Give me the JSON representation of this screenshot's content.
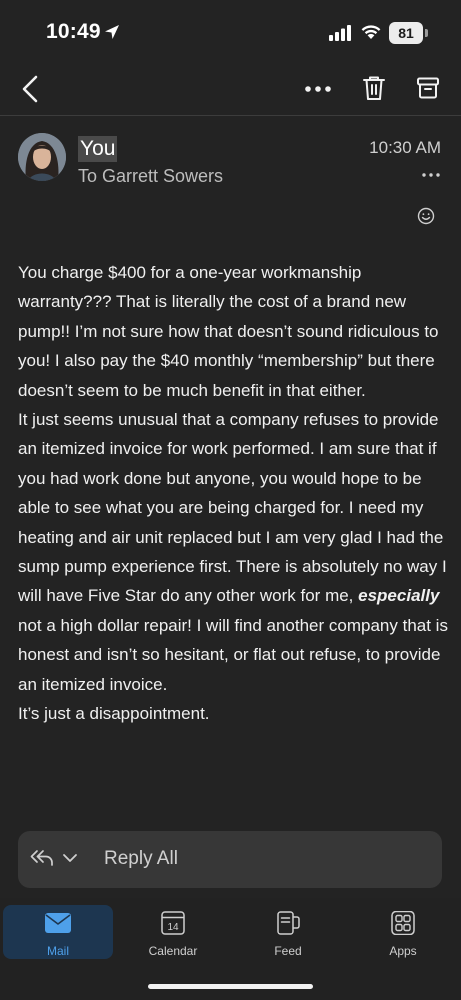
{
  "status_bar": {
    "time": "10:49",
    "battery": "81"
  },
  "toolbar": {
    "back_icon": "chevron-left-icon",
    "more_icon": "ellipsis-icon",
    "delete_icon": "trash-icon",
    "archive_icon": "archive-icon"
  },
  "message": {
    "sender": "You",
    "recipient": "To Garrett Sowers",
    "time": "10:30 AM",
    "body": {
      "p1": "You charge $400 for a one-year workmanship warranty??? That is literally the cost of a brand new pump!! I’m not sure how that doesn’t sound ridiculous to you!  I also pay the $40 monthly “membership” but there doesn’t seem to be much benefit in that either.",
      "p2_before": "It just seems unusual  that a company refuses to provide an itemized invoice for work performed. I am sure that if you had work done but anyone, you would hope to be able to see what you are being charged for. I need my heating and air unit replaced but I am very glad I had the sump pump experience first. There is absolutely no way I will have Five Star do any other work for me, ",
      "p2_emphasis": "especially",
      "p2_after": " not a high dollar repair! I will find another company that is honest and isn’t so hesitant, or flat out refuse, to provide an itemized invoice.",
      "p3": "It’s just a disappointment."
    }
  },
  "reply_bar": {
    "label": "Reply All"
  },
  "tabs": [
    {
      "label": "Mail",
      "icon": "mail-icon",
      "active": true
    },
    {
      "label": "Calendar",
      "icon": "calendar-icon",
      "active": false,
      "day": "14"
    },
    {
      "label": "Feed",
      "icon": "feed-icon",
      "active": false
    },
    {
      "label": "Apps",
      "icon": "apps-icon",
      "active": false
    }
  ],
  "colors": {
    "background": "#232323",
    "accent": "#4ea0ea",
    "active_tab_bg": "#1d3650"
  }
}
